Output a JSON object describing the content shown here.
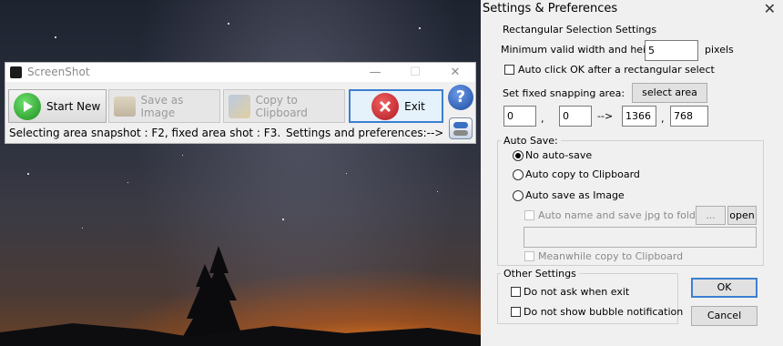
{
  "screenshot_window": {
    "title": "ScreenShot",
    "minimize_glyph": "—",
    "maximize_glyph": "☐",
    "close_glyph": "✕",
    "buttons": {
      "start_new": "Start New",
      "save_as_image": "Save as Image",
      "copy_to_clipboard": "Copy to Clipboard",
      "exit": "Exit"
    },
    "help_glyph": "?",
    "hint_shortcuts": "Selecting area snapshot : F2, fixed area shot : F3.",
    "hint_settings": "Settings and preferences:-->"
  },
  "settings_window": {
    "title": "Settings & Preferences",
    "close_glyph": "✕",
    "rect_group": {
      "label": "Rectangular Selection Settings",
      "min_size_label": "Minimum valid width and height:",
      "min_size_value": "5",
      "min_size_unit": "pixels",
      "auto_ok_label": "Auto click OK after a rectangular select",
      "auto_ok_checked": false,
      "snap_label": "Set fixed snapping area:",
      "select_area_button": "select area",
      "x1": "0",
      "comma1": ",",
      "y1": "0",
      "arrow": "-->",
      "x2": "1366",
      "comma2": ",",
      "y2": "768"
    },
    "autosave_group": {
      "label": "Auto Save:",
      "options": [
        "No auto-save",
        "Auto copy to Clipboard",
        "Auto save as Image"
      ],
      "selected_index": 0,
      "auto_name_label": "Auto name and save jpg to folder:",
      "browse_button": "...",
      "open_button": "open",
      "folder_path": "",
      "meanwhile_label": "Meanwhile copy to Clipboard"
    },
    "other_group": {
      "label": "Other Settings",
      "no_ask_label": "Do not ask when exit",
      "no_bubble_label": "Do not show bubble notification"
    },
    "ok_button": "OK",
    "cancel_button": "Cancel"
  },
  "colors": {
    "accent": "#3c7fd1",
    "start_green": "#2aa52a",
    "exit_red": "#c8232c",
    "help_blue": "#2b5fb5"
  }
}
